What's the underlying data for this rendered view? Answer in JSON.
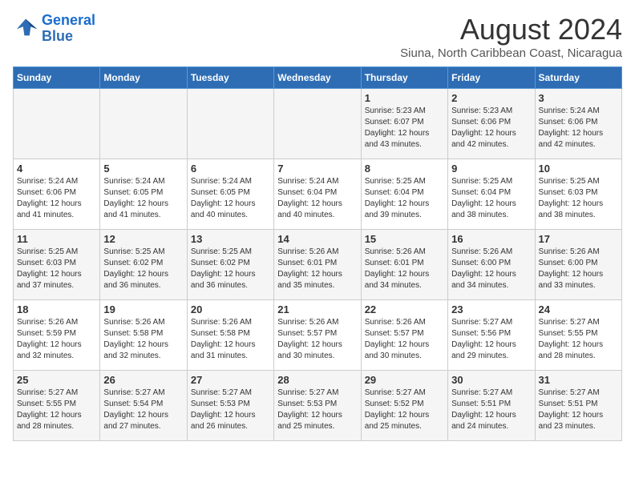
{
  "logo": {
    "line1": "General",
    "line2": "Blue"
  },
  "title": "August 2024",
  "subtitle": "Siuna, North Caribbean Coast, Nicaragua",
  "weekdays": [
    "Sunday",
    "Monday",
    "Tuesday",
    "Wednesday",
    "Thursday",
    "Friday",
    "Saturday"
  ],
  "weeks": [
    [
      {
        "day": "",
        "info": ""
      },
      {
        "day": "",
        "info": ""
      },
      {
        "day": "",
        "info": ""
      },
      {
        "day": "",
        "info": ""
      },
      {
        "day": "1",
        "info": "Sunrise: 5:23 AM\nSunset: 6:07 PM\nDaylight: 12 hours\nand 43 minutes."
      },
      {
        "day": "2",
        "info": "Sunrise: 5:23 AM\nSunset: 6:06 PM\nDaylight: 12 hours\nand 42 minutes."
      },
      {
        "day": "3",
        "info": "Sunrise: 5:24 AM\nSunset: 6:06 PM\nDaylight: 12 hours\nand 42 minutes."
      }
    ],
    [
      {
        "day": "4",
        "info": "Sunrise: 5:24 AM\nSunset: 6:06 PM\nDaylight: 12 hours\nand 41 minutes."
      },
      {
        "day": "5",
        "info": "Sunrise: 5:24 AM\nSunset: 6:05 PM\nDaylight: 12 hours\nand 41 minutes."
      },
      {
        "day": "6",
        "info": "Sunrise: 5:24 AM\nSunset: 6:05 PM\nDaylight: 12 hours\nand 40 minutes."
      },
      {
        "day": "7",
        "info": "Sunrise: 5:24 AM\nSunset: 6:04 PM\nDaylight: 12 hours\nand 40 minutes."
      },
      {
        "day": "8",
        "info": "Sunrise: 5:25 AM\nSunset: 6:04 PM\nDaylight: 12 hours\nand 39 minutes."
      },
      {
        "day": "9",
        "info": "Sunrise: 5:25 AM\nSunset: 6:04 PM\nDaylight: 12 hours\nand 38 minutes."
      },
      {
        "day": "10",
        "info": "Sunrise: 5:25 AM\nSunset: 6:03 PM\nDaylight: 12 hours\nand 38 minutes."
      }
    ],
    [
      {
        "day": "11",
        "info": "Sunrise: 5:25 AM\nSunset: 6:03 PM\nDaylight: 12 hours\nand 37 minutes."
      },
      {
        "day": "12",
        "info": "Sunrise: 5:25 AM\nSunset: 6:02 PM\nDaylight: 12 hours\nand 36 minutes."
      },
      {
        "day": "13",
        "info": "Sunrise: 5:25 AM\nSunset: 6:02 PM\nDaylight: 12 hours\nand 36 minutes."
      },
      {
        "day": "14",
        "info": "Sunrise: 5:26 AM\nSunset: 6:01 PM\nDaylight: 12 hours\nand 35 minutes."
      },
      {
        "day": "15",
        "info": "Sunrise: 5:26 AM\nSunset: 6:01 PM\nDaylight: 12 hours\nand 34 minutes."
      },
      {
        "day": "16",
        "info": "Sunrise: 5:26 AM\nSunset: 6:00 PM\nDaylight: 12 hours\nand 34 minutes."
      },
      {
        "day": "17",
        "info": "Sunrise: 5:26 AM\nSunset: 6:00 PM\nDaylight: 12 hours\nand 33 minutes."
      }
    ],
    [
      {
        "day": "18",
        "info": "Sunrise: 5:26 AM\nSunset: 5:59 PM\nDaylight: 12 hours\nand 32 minutes."
      },
      {
        "day": "19",
        "info": "Sunrise: 5:26 AM\nSunset: 5:58 PM\nDaylight: 12 hours\nand 32 minutes."
      },
      {
        "day": "20",
        "info": "Sunrise: 5:26 AM\nSunset: 5:58 PM\nDaylight: 12 hours\nand 31 minutes."
      },
      {
        "day": "21",
        "info": "Sunrise: 5:26 AM\nSunset: 5:57 PM\nDaylight: 12 hours\nand 30 minutes."
      },
      {
        "day": "22",
        "info": "Sunrise: 5:26 AM\nSunset: 5:57 PM\nDaylight: 12 hours\nand 30 minutes."
      },
      {
        "day": "23",
        "info": "Sunrise: 5:27 AM\nSunset: 5:56 PM\nDaylight: 12 hours\nand 29 minutes."
      },
      {
        "day": "24",
        "info": "Sunrise: 5:27 AM\nSunset: 5:55 PM\nDaylight: 12 hours\nand 28 minutes."
      }
    ],
    [
      {
        "day": "25",
        "info": "Sunrise: 5:27 AM\nSunset: 5:55 PM\nDaylight: 12 hours\nand 28 minutes."
      },
      {
        "day": "26",
        "info": "Sunrise: 5:27 AM\nSunset: 5:54 PM\nDaylight: 12 hours\nand 27 minutes."
      },
      {
        "day": "27",
        "info": "Sunrise: 5:27 AM\nSunset: 5:53 PM\nDaylight: 12 hours\nand 26 minutes."
      },
      {
        "day": "28",
        "info": "Sunrise: 5:27 AM\nSunset: 5:53 PM\nDaylight: 12 hours\nand 25 minutes."
      },
      {
        "day": "29",
        "info": "Sunrise: 5:27 AM\nSunset: 5:52 PM\nDaylight: 12 hours\nand 25 minutes."
      },
      {
        "day": "30",
        "info": "Sunrise: 5:27 AM\nSunset: 5:51 PM\nDaylight: 12 hours\nand 24 minutes."
      },
      {
        "day": "31",
        "info": "Sunrise: 5:27 AM\nSunset: 5:51 PM\nDaylight: 12 hours\nand 23 minutes."
      }
    ]
  ]
}
